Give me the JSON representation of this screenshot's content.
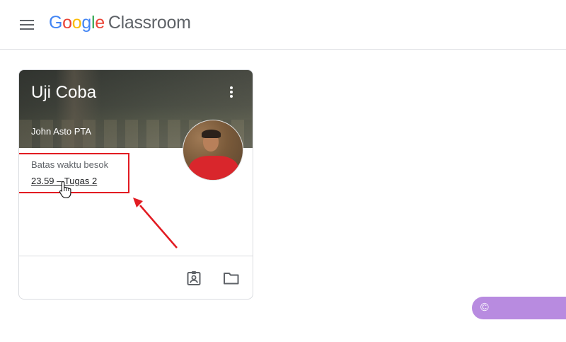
{
  "header": {
    "logo_google": [
      "G",
      "o",
      "o",
      "g",
      "l",
      "e"
    ],
    "logo_google_colors": [
      "#4285F4",
      "#EA4335",
      "#FBBC05",
      "#4285F4",
      "#34A853",
      "#EA4335"
    ],
    "logo_product": "Classroom"
  },
  "card": {
    "title": "Uji Coba",
    "teacher": "John Asto PTA",
    "due_label": "Batas waktu besok",
    "due_link": "23.59 – Tugas 2"
  },
  "icons": {
    "menu": "hamburger-icon",
    "more": "more-vert-icon",
    "work": "assignment-ind-icon",
    "folder": "folder-icon",
    "cursor": "hand-pointer-icon"
  },
  "annotation": {
    "highlight_color": "#e21b22"
  },
  "watermark": {
    "text": "© TAHUPOST.NET"
  }
}
